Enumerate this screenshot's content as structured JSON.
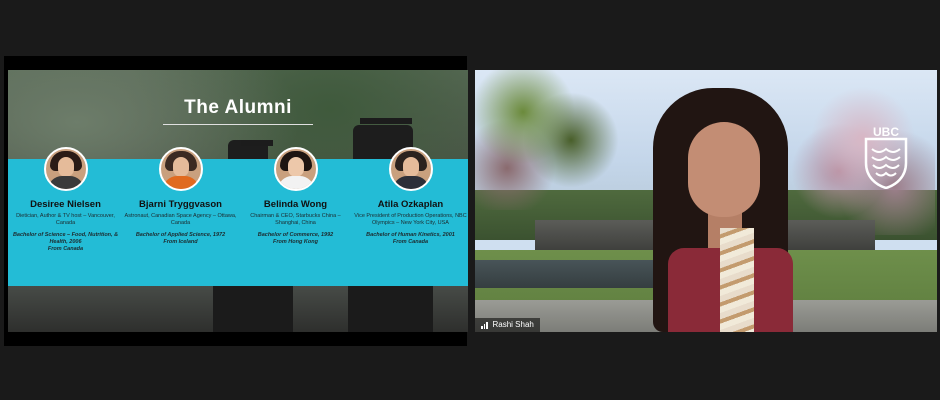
{
  "slide": {
    "title": "The Alumni",
    "alumni": [
      {
        "name": "Desiree Nielsen",
        "role": "Dietician, Author & TV host – Vancouver, Canada",
        "degree": "Bachelor of Science – Food, Nutrition, & Health, 2006",
        "origin": "From Canada"
      },
      {
        "name": "Bjarni Tryggvason",
        "role": "Astronaut, Canadian Space Agency – Ottawa, Canada",
        "degree": "Bachelor of Applied Science, 1972",
        "origin": "From Iceland"
      },
      {
        "name": "Belinda Wong",
        "role": "Chairman & CEO, Starbucks China – Shanghai, China",
        "degree": "Bachelor of Commerce, 1992",
        "origin": "From Hong Kong"
      },
      {
        "name": "Atila Ozkaplan",
        "role": "Vice President of Production Operations, NBC Olympics – New York City, USA",
        "degree": "Bachelor of Human Kinetics, 2001",
        "origin": "From Canada"
      }
    ],
    "colors": {
      "band": "#23bcd6"
    }
  },
  "participant": {
    "name": "Rashi Shah",
    "logo_text": "UBC",
    "icon": "signal-bars-icon"
  }
}
